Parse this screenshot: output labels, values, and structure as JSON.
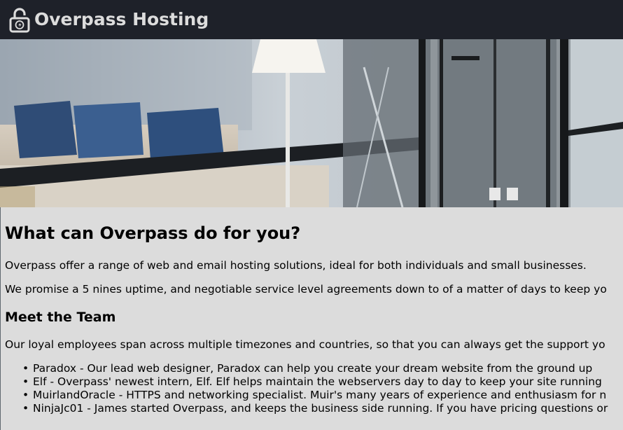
{
  "header": {
    "brand": "Overpass Hosting",
    "logo_icon": "unlocked-padlock-icon",
    "background": "#1e2129",
    "text_color": "#dcdcdc"
  },
  "hero": {
    "image": "office-lounge-photo"
  },
  "main": {
    "heading": "What can Overpass do for you?",
    "intro": "Overpass offer a range of web and email hosting solutions, ideal for both individuals and small businesses.",
    "promise": "We promise a 5 nines uptime, and negotiable service level agreements down to of a matter of days to keep yo",
    "team_heading": "Meet the Team",
    "team_intro": "Our loyal employees span across multiple timezones and countries, so that you can always get the support yo",
    "team": [
      {
        "text": "Paradox - Our lead web designer, Paradox can help you create your dream website from the ground up"
      },
      {
        "text": "Elf - Overpass' newest intern, Elf. Elf helps maintain the webservers day to day to keep your site running"
      },
      {
        "text": "MuirlandOracle - HTTPS and networking specialist. Muir's many years of experience and enthusiasm for n"
      },
      {
        "text": "NinjaJc01 - James started Overpass, and keeps the business side running. If you have pricing questions or"
      }
    ]
  }
}
